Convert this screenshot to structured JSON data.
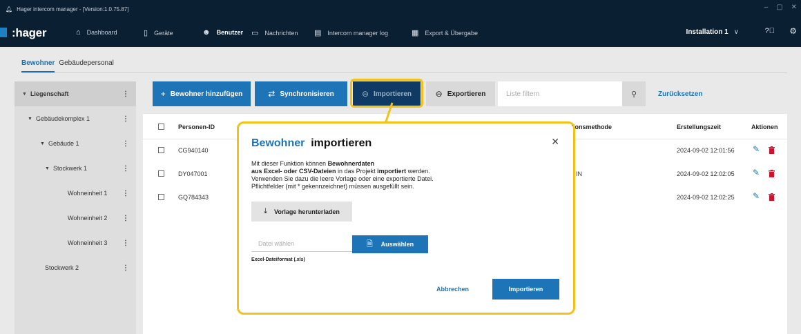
{
  "window": {
    "title": "Hager intercom manager - [Version:1.0.75.87]",
    "controls": [
      "–",
      "▢",
      "✕"
    ]
  },
  "nav": {
    "logo": ":hager",
    "items": [
      {
        "label": "Dashboard",
        "icon": "dashboard-icon",
        "active": false
      },
      {
        "label": "Geräte",
        "icon": "device-icon",
        "active": false
      },
      {
        "label": "Benutzer",
        "icon": "users-icon",
        "active": true
      },
      {
        "label": "Nachrichten",
        "icon": "message-icon",
        "active": false
      },
      {
        "label": "Intercom manager log",
        "icon": "log-icon",
        "active": false
      },
      {
        "label": "Export & Übergabe",
        "icon": "export-handover-icon",
        "active": false
      }
    ],
    "installation": "Installation 1",
    "help_icon": "help-icon",
    "settings_icon": "gear-icon"
  },
  "tabs": [
    {
      "label": "Bewohner",
      "active": true
    },
    {
      "label": "Gebäudepersonal",
      "active": false
    }
  ],
  "sidebar": {
    "items": [
      {
        "label": "Liegenschaft",
        "caret": true
      },
      {
        "label": "Gebäudekomplex 1",
        "caret": true
      },
      {
        "label": "Gebäude 1",
        "caret": true
      },
      {
        "label": "Stockwerk 1",
        "caret": true
      },
      {
        "label": "Wohneinheit 1",
        "caret": false
      },
      {
        "label": "Wohneinheit 2",
        "caret": false
      },
      {
        "label": "Wohneinheit 3",
        "caret": false
      },
      {
        "label": "Stockwerk 2",
        "caret": false
      }
    ],
    "menu_glyph": "⋮"
  },
  "toolbar": {
    "add_label": "Bewohner hinzufügen",
    "sync_label": "Synchronisieren",
    "import_label": "Importieren",
    "export_label": "Exportieren",
    "filter_placeholder": "Liste filtern",
    "reset_label": "Zurücksetzen"
  },
  "table": {
    "columns": {
      "id": "Personen-ID",
      "method": "tionsmethode",
      "created": "Erstellungszeit",
      "actions": "Aktionen"
    },
    "rows": [
      {
        "id": "CG940140",
        "method": "",
        "created": "2024-09-02 12:01:56"
      },
      {
        "id": "DY047001",
        "method": "IN",
        "created": "2024-09-02 12:02:05"
      },
      {
        "id": "GQ784343",
        "method": "",
        "created": "2024-09-02 12:02:25"
      }
    ]
  },
  "modal": {
    "title_accent": "Bewohner",
    "title_rest": "importieren",
    "desc": {
      "p1": "Mit dieser Funktion können ",
      "b1": "Bewohnerdaten",
      "b2": "aus Excel- oder CSV-Dateien",
      "p2": " in das Projekt ",
      "b3": "importiert",
      "p3": " werden.",
      "line3": "Verwenden Sie dazu die leere Vorlage oder eine exportierte Datei.",
      "line4": "Pflichtfelder (mit * gekennzeichnet) müssen ausgefüllt sein."
    },
    "download_label": "Vorlage herunterladen",
    "file_placeholder": "Datei wählen",
    "choose_label": "Auswählen",
    "file_hint": "Excel-Dateiformat (.xls)",
    "cancel_label": "Abbrechen",
    "import_label": "Importieren"
  },
  "colors": {
    "navbar": "#0b1f33",
    "primary": "#1d75b8",
    "highlight": "#f2c21b",
    "delete": "#d0112b"
  }
}
